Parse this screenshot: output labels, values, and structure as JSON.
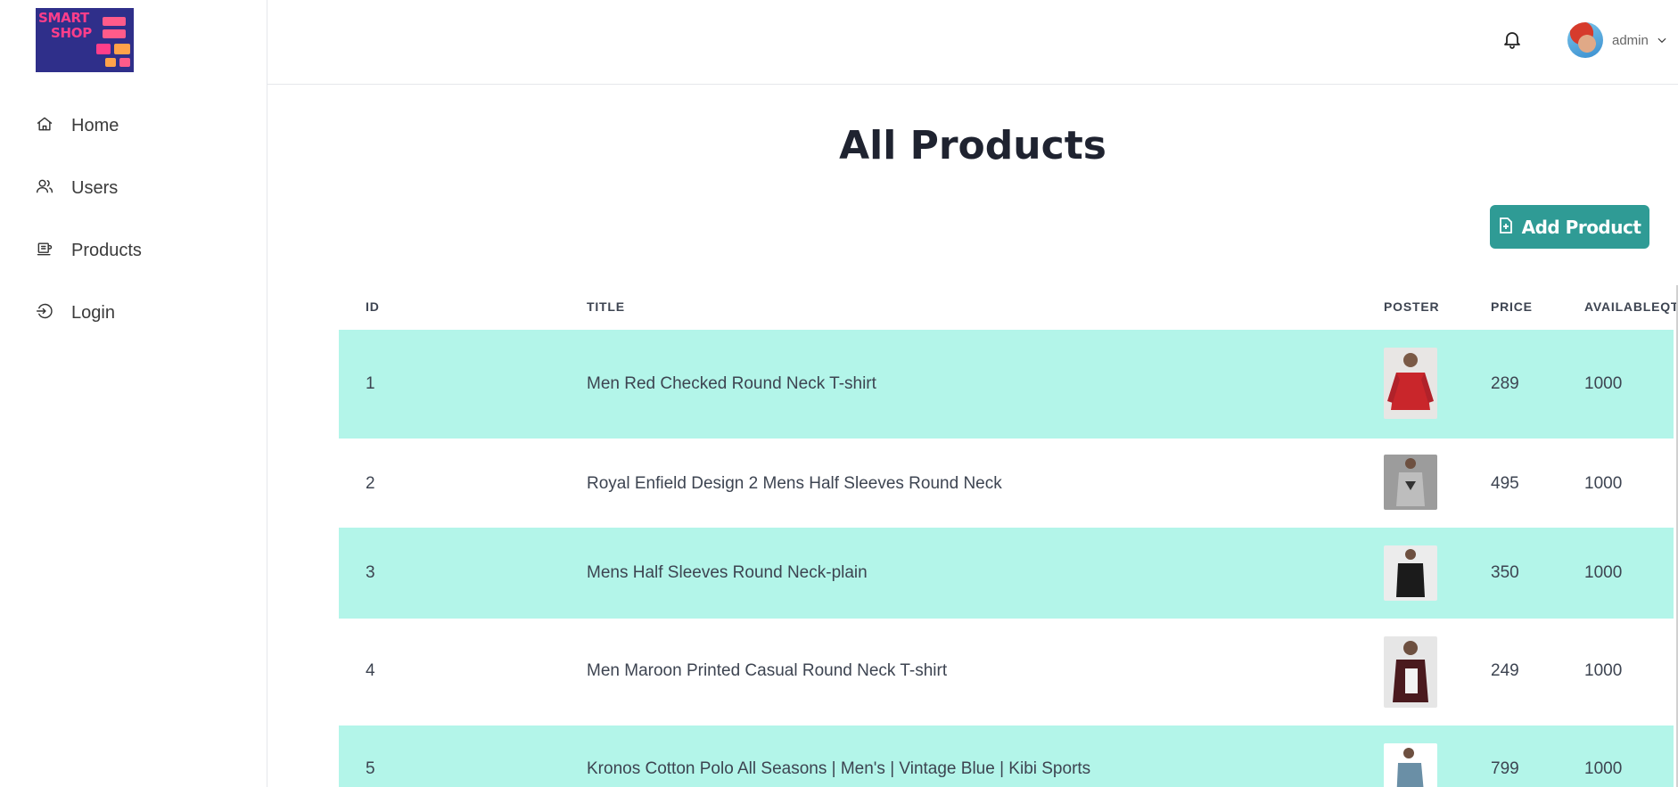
{
  "brand": {
    "line1": "SMART",
    "line2": "SHOP"
  },
  "sidebar": {
    "items": [
      {
        "label": "Home",
        "icon": "home-icon"
      },
      {
        "label": "Users",
        "icon": "users-icon"
      },
      {
        "label": "Products",
        "icon": "products-icon"
      },
      {
        "label": "Login",
        "icon": "login-icon"
      }
    ]
  },
  "header": {
    "user_name": "admin"
  },
  "main": {
    "title": "All Products",
    "add_button_label": "Add Product",
    "columns": [
      "ID",
      "TITLE",
      "POSTER",
      "PRICE",
      "AVAILABLEQT"
    ],
    "rows": [
      {
        "id": "1",
        "title": "Men Red Checked Round Neck T-shirt",
        "price": "289",
        "qty": "1000",
        "poster_color": "#c9262b"
      },
      {
        "id": "2",
        "title": "Royal Enfield Design 2 Mens Half Sleeves Round Neck",
        "price": "495",
        "qty": "1000",
        "poster_color": "#8a8a8a"
      },
      {
        "id": "3",
        "title": "Mens Half Sleeves Round Neck-plain",
        "price": "350",
        "qty": "1000",
        "poster_color": "#1b1b1b"
      },
      {
        "id": "4",
        "title": "Men Maroon Printed Casual Round Neck T-shirt",
        "price": "249",
        "qty": "1000",
        "poster_color": "#4a1a1e"
      },
      {
        "id": "5",
        "title": "Kronos Cotton Polo All Seasons | Men's | Vintage Blue | Kibi Sports",
        "price": "799",
        "qty": "1000",
        "poster_color": "#6a8fa6"
      }
    ]
  }
}
